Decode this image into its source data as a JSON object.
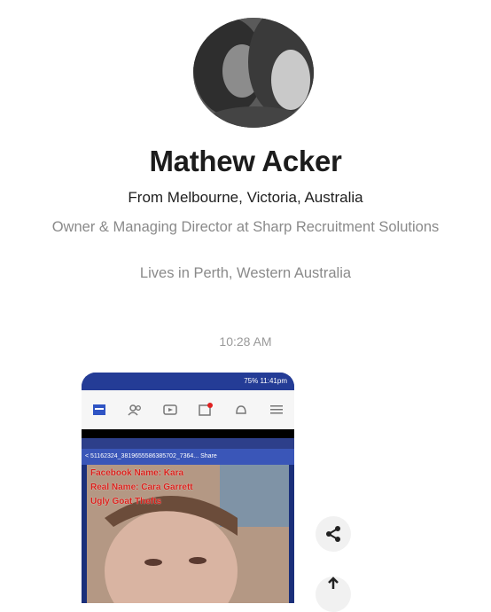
{
  "profile": {
    "name": "Mathew Acker",
    "from": "From Melbourne, Victoria, Australia",
    "work": "Owner & Managing Director at Sharp Recruitment Solutions",
    "lives": "Lives in Perth, Western Australia"
  },
  "message": {
    "timestamp": "10:28 AM"
  },
  "attachment": {
    "status_bar": "75% 11:41pm",
    "video_header": "< 51162324_3819655586385702_7364... Share",
    "overlay_lines": [
      "Facebook Name: Kara",
      "Real Name: Cara Garrett",
      "Ugly Goat Thefts"
    ]
  },
  "icons": {
    "share": "share-icon"
  },
  "colors": {
    "fb_blue": "#243c96",
    "overlay_red": "#d8201a"
  }
}
